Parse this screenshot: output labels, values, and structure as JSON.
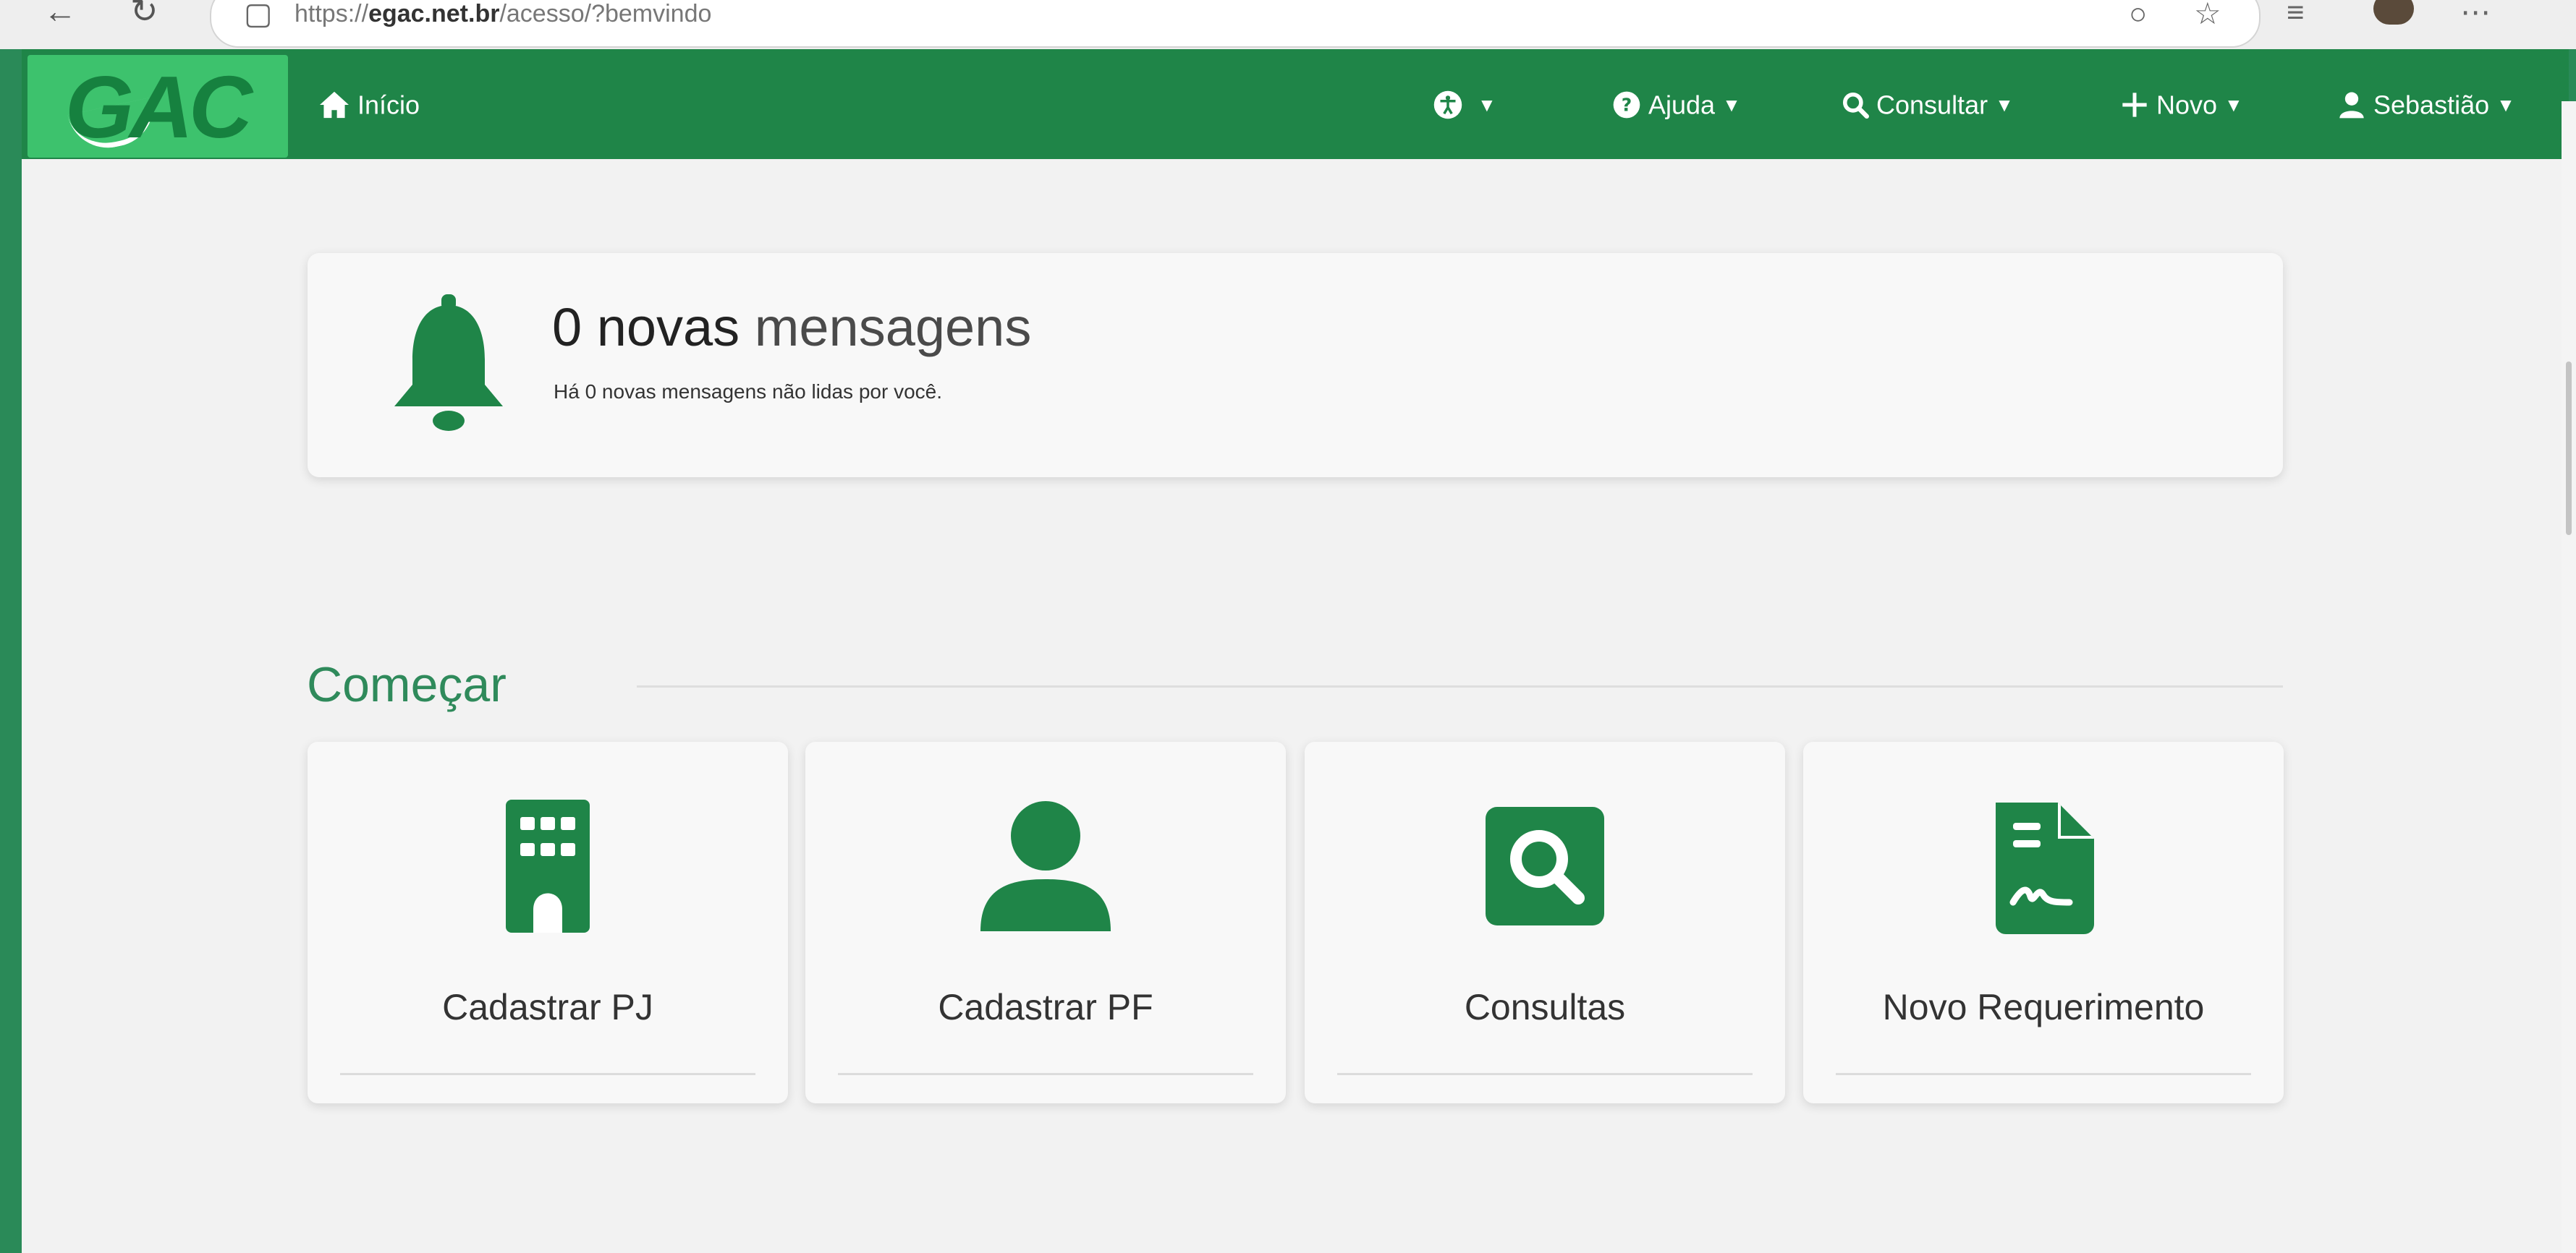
{
  "browser": {
    "url_prefix": "https://",
    "url_domain": "egac.net.br",
    "url_path": "/acesso/?bemvindo"
  },
  "app": {
    "logo": "eGAC",
    "colors": {
      "primary": "#1f8548",
      "logo_bg": "#3dc26d",
      "accent_text": "#2f8a5b"
    }
  },
  "navbar": {
    "home": {
      "label": "Início",
      "icon": "home-icon"
    },
    "accessibility": {
      "icon": "accessibility-icon"
    },
    "help": {
      "label": "Ajuda",
      "icon": "question-circle-icon"
    },
    "consult": {
      "label": "Consultar",
      "icon": "search-icon"
    },
    "new": {
      "label": "Novo",
      "icon": "plus-icon"
    },
    "user": {
      "label": "Sebastião",
      "icon": "user-icon"
    }
  },
  "messages": {
    "count": "0",
    "strong": "novas",
    "light": "mensagens",
    "subtitle": "Há 0 novas mensagens não lidas por você."
  },
  "start": {
    "title": "Começar",
    "cards": [
      {
        "label": "Cadastrar PJ",
        "icon": "building-icon"
      },
      {
        "label": "Cadastrar PF",
        "icon": "person-icon"
      },
      {
        "label": "Consultas",
        "icon": "search-square-icon"
      },
      {
        "label": "Novo Requerimento",
        "icon": "document-signature-icon"
      }
    ]
  }
}
